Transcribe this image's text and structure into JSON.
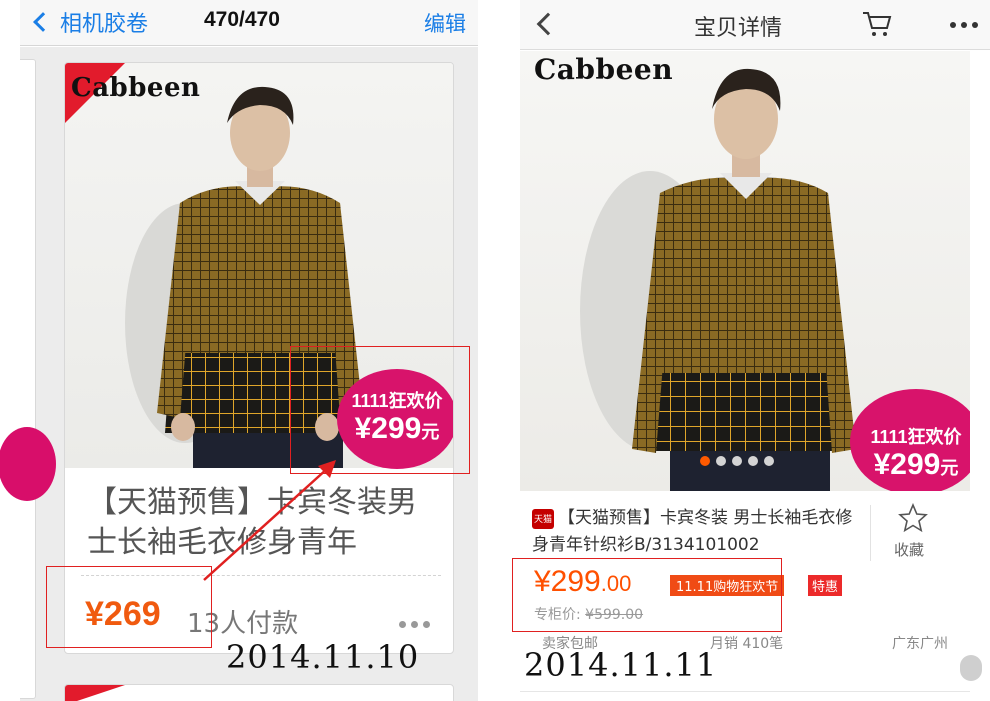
{
  "left": {
    "header": {
      "back_label": "相机胶卷",
      "count": "470/470",
      "edit_label": "编辑"
    },
    "card": {
      "brand": "Cabbeen",
      "badge_line1": "1111狂欢价",
      "badge_price": "¥299",
      "badge_unit": "元",
      "title": "【天猫预售】卡宾冬装男士长袖毛衣修身青年",
      "price": "¥269",
      "sold": "13人付款"
    },
    "date_caption": "2014.11.10"
  },
  "right": {
    "header": {
      "title": "宝贝详情",
      "icons": [
        "back-chevron-icon",
        "cart-icon",
        "more-dots-icon"
      ]
    },
    "photo": {
      "brand": "Cabbeen",
      "badge_line1": "1111狂欢价",
      "badge_price": "¥299",
      "badge_unit": "元",
      "carousel_total": 5,
      "carousel_active": 1
    },
    "product": {
      "tmall_tag": "天猫",
      "name": "【天猫预售】卡宾冬装 男士长袖毛衣修身青年针织衫B/3134101002",
      "fav_label": "收藏",
      "price_main": "¥299",
      "price_cents": ".00",
      "promo_tag": "11.11购物狂欢节",
      "special_tag": "特惠",
      "orig_label": "专柜价: ",
      "orig_price": "¥599.00",
      "shipping": "卖家包邮",
      "monthly_sales": "月销 410笔",
      "location": "广东广州"
    },
    "date_caption": "2014.11.11"
  },
  "colors": {
    "accent_blue": "#1a7ee6",
    "price_orange": "#f05a0f",
    "badge_magenta": "#d8136b",
    "annotation_red": "#e02020",
    "tmall_red": "#c40000"
  }
}
